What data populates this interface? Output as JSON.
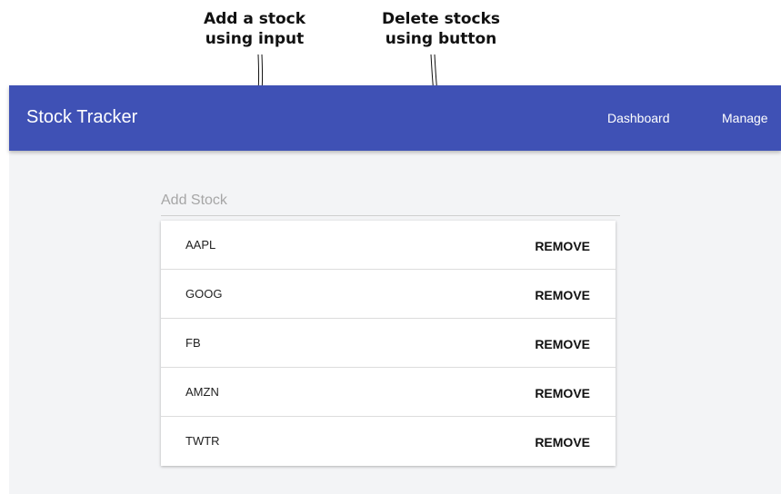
{
  "annotations": {
    "input_note": "Add a stock\nusing input",
    "button_note": "Delete stocks\nusing button"
  },
  "toolbar": {
    "title": "Stock Tracker",
    "nav": [
      "Dashboard",
      "Manage"
    ],
    "color": "#3f51b5"
  },
  "add_stock": {
    "placeholder": "Add Stock",
    "value": ""
  },
  "stocks": [
    {
      "symbol": "AAPL",
      "action": "REMOVE"
    },
    {
      "symbol": "GOOG",
      "action": "REMOVE"
    },
    {
      "symbol": "FB",
      "action": "REMOVE"
    },
    {
      "symbol": "AMZN",
      "action": "REMOVE"
    },
    {
      "symbol": "TWTR",
      "action": "REMOVE"
    }
  ]
}
